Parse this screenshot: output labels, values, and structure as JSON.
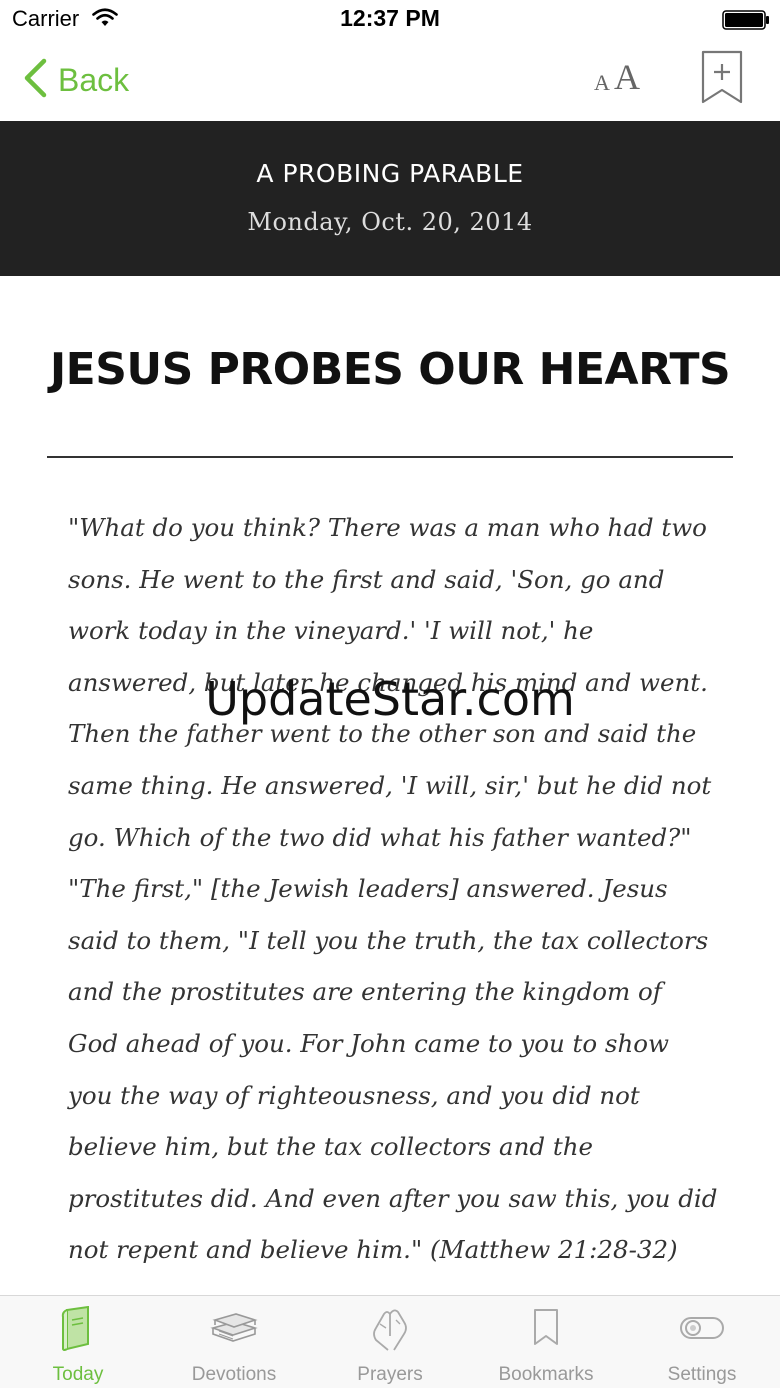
{
  "status_bar": {
    "carrier": "Carrier",
    "time": "12:37 PM"
  },
  "nav": {
    "back_label": "Back",
    "font_size_small": "A",
    "font_size_large": "A"
  },
  "header": {
    "section_title": "A PROBING PARABLE",
    "date": "Monday, Oct. 20, 2014"
  },
  "article": {
    "title": "JESUS PROBES OUR HEARTS",
    "body": "\"What do you think? There was a man who had two sons. He went to the first and said, 'Son, go and work today in the vineyard.' 'I will not,' he answered, but later he changed his mind and went. Then the father went to the other son and said the same thing. He answered, 'I will, sir,' but he did not go. Which of the two did what his father wanted?\" \"The first,\" [the Jewish leaders] answered. Jesus said to them, \"I tell you the truth, the tax collectors and the prostitutes are entering the kingdom of God ahead of you. For John came to you to show you the way of righteousness, and you did not believe him, but the tax collectors and the prostitutes did. And even after you saw this, you did not repent and believe him.\" (Matthew 21:28-32)"
  },
  "watermark": "UpdateStar.com",
  "tabs": [
    {
      "label": "Today",
      "icon": "book-icon",
      "active": true
    },
    {
      "label": "Devotions",
      "icon": "stacked-books-icon",
      "active": false
    },
    {
      "label": "Prayers",
      "icon": "praying-hands-icon",
      "active": false
    },
    {
      "label": "Bookmarks",
      "icon": "bookmark-icon",
      "active": false
    },
    {
      "label": "Settings",
      "icon": "toggle-icon",
      "active": false
    }
  ],
  "colors": {
    "accent": "#6dbf3f",
    "header_background": "#222222",
    "tab_inactive": "#999999"
  }
}
